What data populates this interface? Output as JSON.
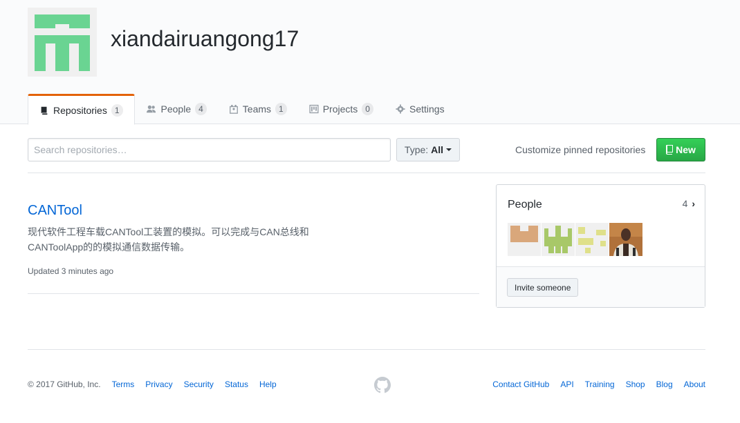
{
  "org": {
    "name": "xiandairuangong17",
    "avatar_icon": "identicon-green"
  },
  "tabs": [
    {
      "label": "Repositories",
      "count": "1",
      "icon": "repo-icon"
    },
    {
      "label": "People",
      "count": "4",
      "icon": "people-icon"
    },
    {
      "label": "Teams",
      "count": "1",
      "icon": "teams-icon"
    },
    {
      "label": "Projects",
      "count": "0",
      "icon": "project-icon"
    },
    {
      "label": "Settings",
      "icon": "gear-icon"
    }
  ],
  "toolbar": {
    "search_placeholder": "Search repositories…",
    "type_label": "Type:",
    "type_value": "All",
    "customize_label": "Customize pinned repositories",
    "new_label": "New"
  },
  "repo": {
    "name": "CANTool",
    "description": "现代软件工程车载CANTool工装置的模拟。可以完成与CAN总线和CANToolApp的的模拟通信数据传输。",
    "updated": "Updated 3 minutes ago"
  },
  "people": {
    "title": "People",
    "count": "4",
    "invite_label": "Invite someone"
  },
  "footer": {
    "copyright": "© 2017 GitHub, Inc.",
    "left_links": [
      "Terms",
      "Privacy",
      "Security",
      "Status",
      "Help"
    ],
    "right_links": [
      "Contact GitHub",
      "API",
      "Training",
      "Shop",
      "Blog",
      "About"
    ]
  },
  "colors": {
    "accent": "#0366d6",
    "new_button": "#28a745",
    "tab_active_border": "#e36209",
    "org_avatar": "#6ad492"
  }
}
